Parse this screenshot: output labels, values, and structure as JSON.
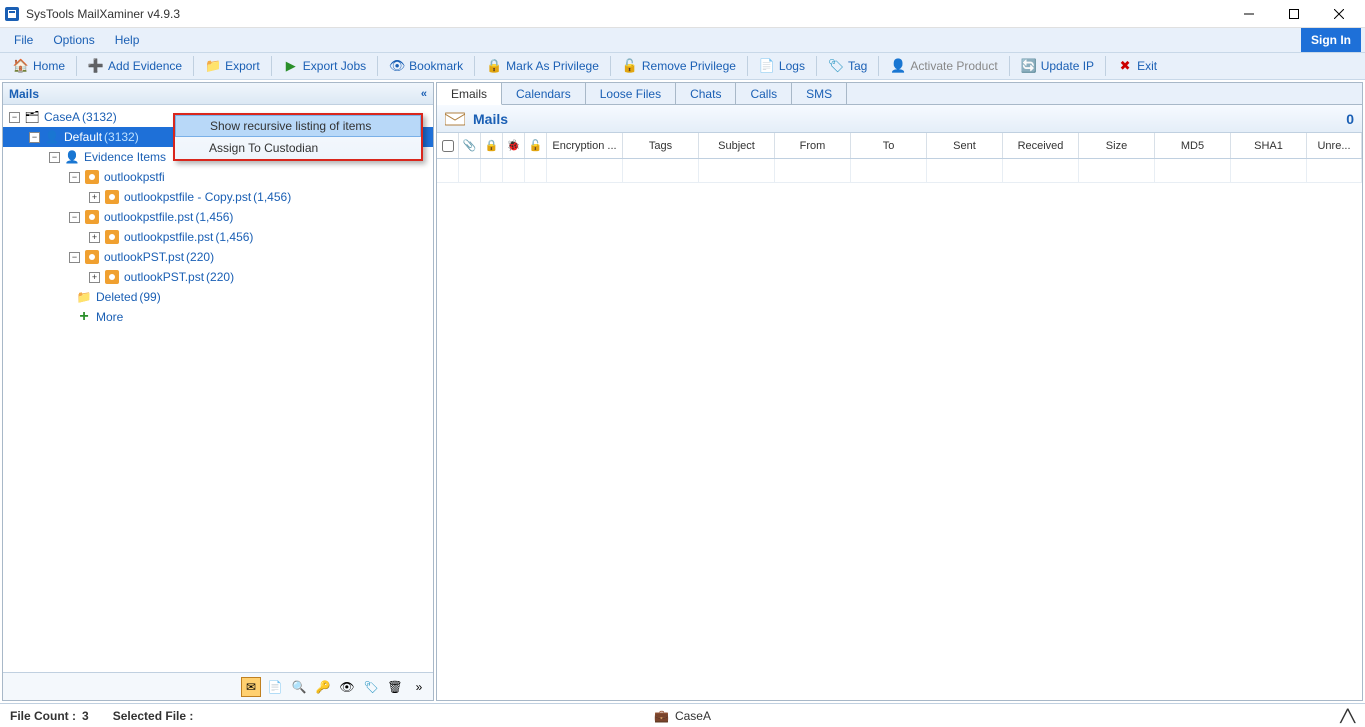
{
  "window": {
    "title": "SysTools MailXaminer v4.9.3"
  },
  "menu": {
    "file": "File",
    "options": "Options",
    "help": "Help",
    "signin": "Sign In"
  },
  "toolbar": {
    "home": "Home",
    "addEvidence": "Add Evidence",
    "export": "Export",
    "exportJobs": "Export Jobs",
    "bookmark": "Bookmark",
    "markPriv": "Mark As Privilege",
    "removePriv": "Remove Privilege",
    "logs": "Logs",
    "tag": "Tag",
    "activate": "Activate Product",
    "updateIP": "Update IP",
    "exit": "Exit"
  },
  "sidebar": {
    "title": "Mails",
    "case": {
      "name": "CaseA",
      "count": "(3132)"
    },
    "default": {
      "name": "Default",
      "count": "(3132)"
    },
    "evidence": "Evidence Items",
    "f1": {
      "name": "outlookpstfi",
      "sub": "outlookpstfile - Copy.pst",
      "subcnt": "(1,456)"
    },
    "f2": {
      "name": "outlookpstfile.pst",
      "cnt": "(1,456)",
      "sub": "outlookpstfile.pst",
      "subcnt": "(1,456)"
    },
    "f3": {
      "name": "outlookPST.pst",
      "cnt": "(220)",
      "sub": "outlookPST.pst",
      "subcnt": "(220)"
    },
    "deleted": {
      "name": "Deleted",
      "cnt": "(99)"
    },
    "more": "More"
  },
  "ctx": {
    "item1": "Show recursive listing of items",
    "item2": "Assign To Custodian"
  },
  "tabs": {
    "emails": "Emails",
    "calendars": "Calendars",
    "loose": "Loose Files",
    "chats": "Chats",
    "calls": "Calls",
    "sms": "SMS"
  },
  "pane": {
    "title": "Mails",
    "count": "0"
  },
  "cols": {
    "enc": "Encryption ...",
    "tags": "Tags",
    "subject": "Subject",
    "from": "From",
    "to": "To",
    "sent": "Sent",
    "received": "Received",
    "size": "Size",
    "md5": "MD5",
    "sha1": "SHA1",
    "unre": "Unre..."
  },
  "status": {
    "fileCountLbl": "File Count :",
    "fileCount": "3",
    "selFileLbl": "Selected File :",
    "case": "CaseA"
  }
}
